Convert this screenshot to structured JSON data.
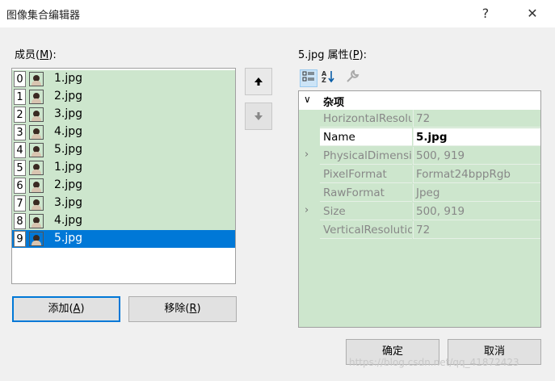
{
  "window": {
    "title": "图像集合编辑器",
    "help": "?",
    "close": "✕"
  },
  "members": {
    "label_prefix": "成员(",
    "label_key": "M",
    "label_suffix": "):",
    "items": [
      {
        "index": "0",
        "name": "1.jpg",
        "selected": false
      },
      {
        "index": "1",
        "name": "2.jpg",
        "selected": false
      },
      {
        "index": "2",
        "name": "3.jpg",
        "selected": false
      },
      {
        "index": "3",
        "name": "4.jpg",
        "selected": false
      },
      {
        "index": "4",
        "name": "5.jpg",
        "selected": false
      },
      {
        "index": "5",
        "name": "1.jpg",
        "selected": false
      },
      {
        "index": "6",
        "name": "2.jpg",
        "selected": false
      },
      {
        "index": "7",
        "name": "3.jpg",
        "selected": false
      },
      {
        "index": "8",
        "name": "4.jpg",
        "selected": false
      },
      {
        "index": "9",
        "name": "5.jpg",
        "selected": true
      }
    ],
    "row_bg": "#cde6cd",
    "selected_bg": "#0078d7",
    "move_up_icon": "arrow-up-icon",
    "move_down_icon": "arrow-down-icon"
  },
  "buttons": {
    "add_prefix": "添加(",
    "add_key": "A",
    "add_suffix": ")",
    "remove_prefix": "移除(",
    "remove_key": "R",
    "remove_suffix": ")",
    "ok": "确定",
    "cancel": "取消"
  },
  "properties": {
    "label_prefix": "5.jpg 属性(",
    "label_key": "P",
    "label_suffix": "):",
    "toolbar": [
      "categorized-icon",
      "alphabetical-icon",
      "property-pages-icon"
    ],
    "category": {
      "chevron": "∨",
      "label": "杂项"
    },
    "rows": [
      {
        "name": "HorizontalResolution",
        "value": "72",
        "expandable": false,
        "selected": false
      },
      {
        "name": "Name",
        "value": "5.jpg",
        "expandable": false,
        "selected": true
      },
      {
        "name": "PhysicalDimension",
        "value": "500, 919",
        "expandable": true,
        "selected": false
      },
      {
        "name": "PixelFormat",
        "value": "Format24bppRgb",
        "expandable": false,
        "selected": false
      },
      {
        "name": "RawFormat",
        "value": "Jpeg",
        "expandable": false,
        "selected": false
      },
      {
        "name": "Size",
        "value": "500, 919",
        "expandable": true,
        "selected": false
      },
      {
        "name": "VerticalResolution",
        "value": "72",
        "expandable": false,
        "selected": false
      }
    ],
    "grid_bg": "#cde6cd"
  },
  "watermark": "https://blog.csdn.net/qq_41872423"
}
